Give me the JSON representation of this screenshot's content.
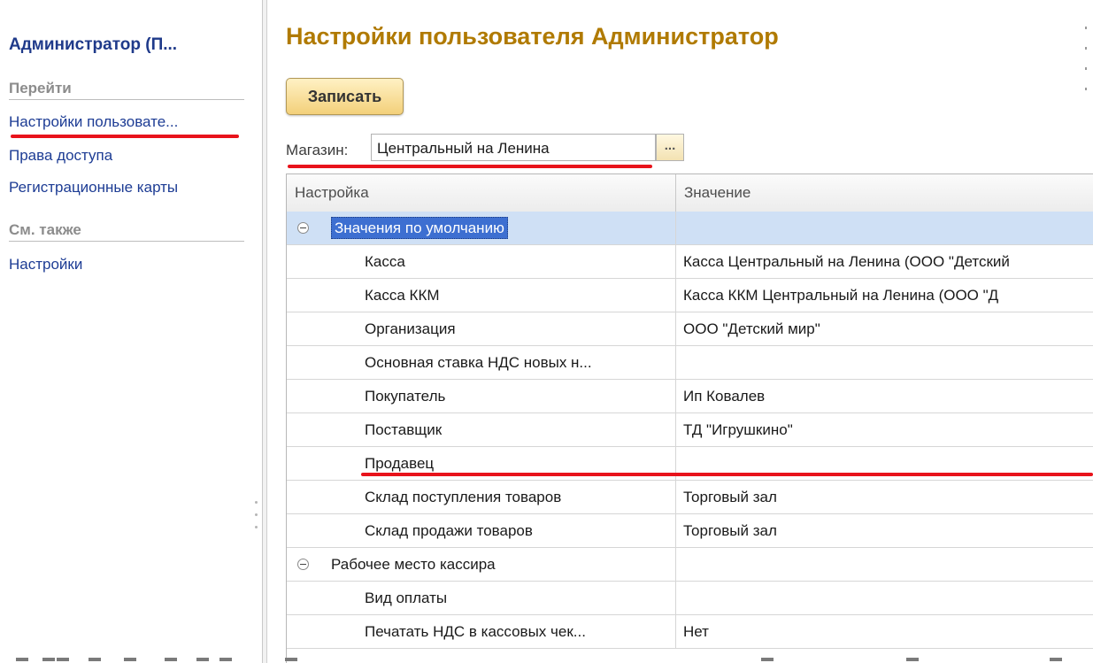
{
  "nav": {
    "title": "Администратор (П...",
    "go_section": "Перейти",
    "go_items": [
      "Настройки пользовате...",
      "Права доступа",
      "Регистрационные карты"
    ],
    "see_also_section": "См. также",
    "see_also_items": [
      "Настройки"
    ]
  },
  "form": {
    "title": "Настройки пользователя Администратор",
    "save_label": "Записать",
    "store_label": "Магазин:",
    "store_value": "Центральный на Ленина",
    "store_select_button": "..."
  },
  "grid": {
    "columns": [
      "Настройка",
      "Значение"
    ],
    "rows": [
      {
        "name": "Значения по умолчанию",
        "value": "",
        "group": true,
        "selected": true
      },
      {
        "name": "Касса",
        "value": "Касса Центральный на Ленина (ООО \"Детский"
      },
      {
        "name": "Касса ККМ",
        "value": "Касса ККМ Центральный на Ленина (ООО \"Д"
      },
      {
        "name": "Организация",
        "value": "ООО \"Детский мир\""
      },
      {
        "name": "Основная ставка НДС новых н...",
        "value": ""
      },
      {
        "name": "Покупатель",
        "value": "Ип Ковалев"
      },
      {
        "name": "Поставщик",
        "value": "ТД \"Игрушкино\""
      },
      {
        "name": "Продавец",
        "value": ""
      },
      {
        "name": "Склад поступления товаров",
        "value": "Торговый зал"
      },
      {
        "name": "Склад продажи товаров",
        "value": "Торговый зал"
      },
      {
        "name": "Рабочее место кассира",
        "value": "",
        "group": true
      },
      {
        "name": "Вид оплаты",
        "value": ""
      },
      {
        "name": "Печатать НДС в кассовых чек...",
        "value": "Нет"
      }
    ]
  },
  "colors": {
    "title": "#b07a00",
    "nav_link": "#1d3c94",
    "highlight_underline": "#e8131b",
    "row_selected": "#cfe0f5",
    "group_selected": "#3d6fd1"
  }
}
